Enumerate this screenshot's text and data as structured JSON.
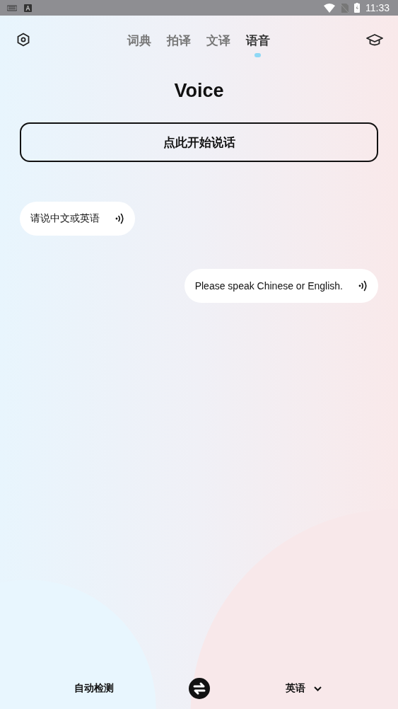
{
  "status_bar": {
    "time": "11:33"
  },
  "tabs": [
    {
      "label": "词典",
      "selected": false
    },
    {
      "label": "拍译",
      "selected": false
    },
    {
      "label": "文译",
      "selected": false
    },
    {
      "label": "语音",
      "selected": true
    }
  ],
  "title": "Voice",
  "start_button": "点此开始说话",
  "messages": [
    {
      "kind": "incoming",
      "text": "请说中文或英语"
    },
    {
      "kind": "outgoing",
      "text": "Please speak Chinese or English."
    }
  ],
  "languages": {
    "source": "自动检测",
    "target": "英语"
  }
}
